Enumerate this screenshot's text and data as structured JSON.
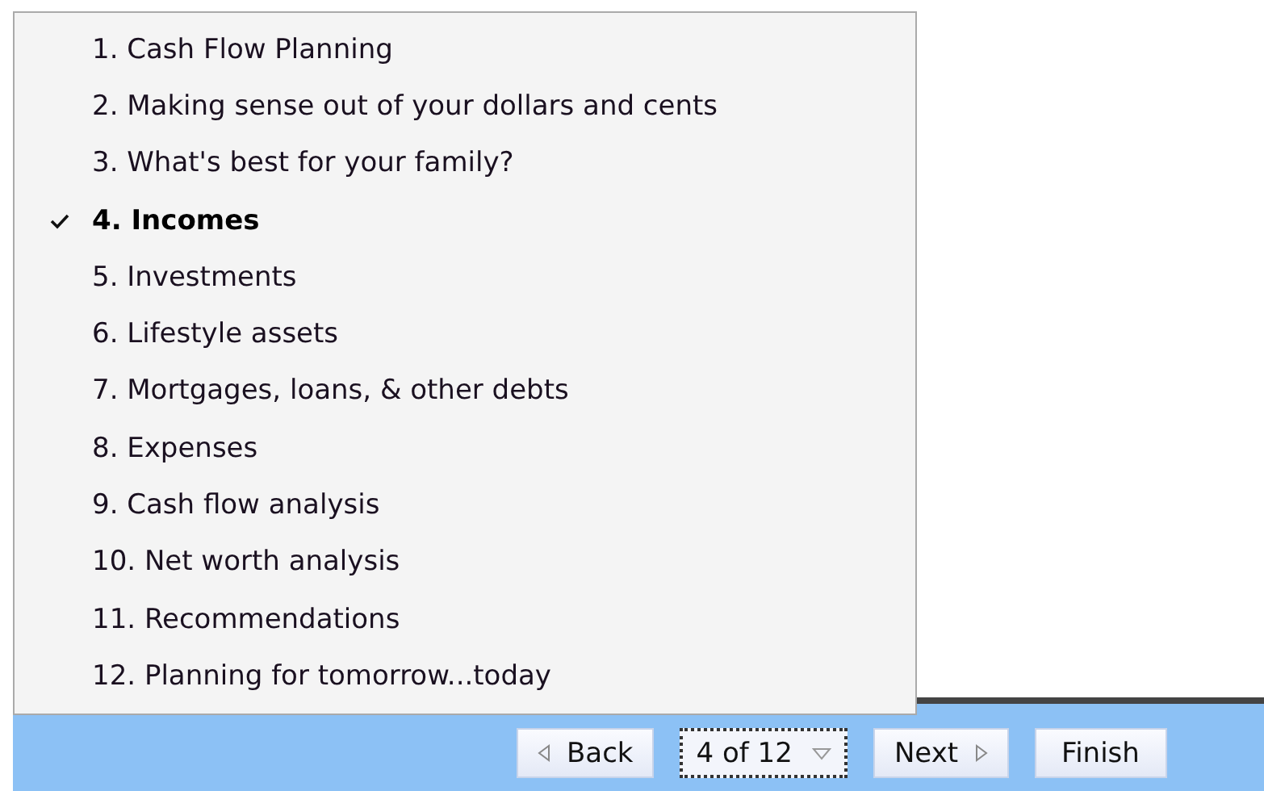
{
  "menu": {
    "items": [
      {
        "label": "1. Cash Flow Planning",
        "selected": false
      },
      {
        "label": "2. Making sense out of your dollars and cents",
        "selected": false
      },
      {
        "label": "3. What's best for your family?",
        "selected": false
      },
      {
        "label": "4. Incomes",
        "selected": true
      },
      {
        "label": "5. Investments",
        "selected": false
      },
      {
        "label": "6. Lifestyle assets",
        "selected": false
      },
      {
        "label": "7. Mortgages, loans, & other debts",
        "selected": false
      },
      {
        "label": "8. Expenses",
        "selected": false
      },
      {
        "label": "9. Cash flow analysis",
        "selected": false
      },
      {
        "label": "10. Net worth analysis",
        "selected": false
      },
      {
        "label": "11. Recommendations",
        "selected": false
      },
      {
        "label": "12. Planning for tomorrow...today",
        "selected": false
      }
    ]
  },
  "toolbar": {
    "back": "Back",
    "page_selector": "4 of 12",
    "next": "Next",
    "finish": "Finish"
  }
}
